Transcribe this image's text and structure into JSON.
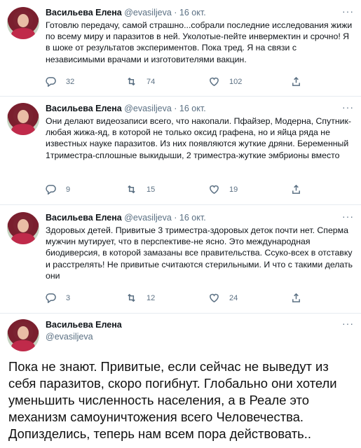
{
  "tweets": [
    {
      "name": "Васильева Елена",
      "handle": "@evasiljeva",
      "dot": "·",
      "date": "16 окт.",
      "text": "Готовлю передачу, самой страшно...собрали последние исследования жижи по всему миру и паразитов в ней. Уколотые-пейте инвермектин и срочно! Я в шоке от результатов экспериментов. Пока тред. Я на связи с независимыми врачами и изготовителями вакцин.",
      "replies": "32",
      "retweets": "74",
      "likes": "102"
    },
    {
      "name": "Васильева Елена",
      "handle": "@evasiljeva",
      "dot": "·",
      "date": "16 окт.",
      "text": "Они делают видеозаписи всего, что накопали. Пфайзер, Модерна, Спутник-любая жижа-яд, в которой не только оксид графена, но и яйца ряда не известных науке паразитов. Из них появляются жуткие дряни. Беременный 1триместра-сплошные выкидыши, 2 триместра-жуткие эмбрионы вместо",
      "replies": "9",
      "retweets": "15",
      "likes": "19"
    },
    {
      "name": "Васильева Елена",
      "handle": "@evasiljeva",
      "dot": "·",
      "date": "16 окт.",
      "text": "Здоровых детей. Привитые 3 триместра-здоровых деток почти нет. Сперма мужчин мутирует, что в перспективе-не ясно. Это международная биодиверсия, в которой замазаны все правительства. Ссуко-всех в отставку и расстрелять! Не привитые считаются стерильными. И что с такими делать они",
      "replies": "3",
      "retweets": "12",
      "likes": "24"
    }
  ],
  "last_tweet": {
    "name": "Васильева Елена",
    "handle": "@evasiljeva",
    "text": "Пока не знают. Привитые, если сейчас не выведут из себя паразитов, скоро погибнут. Глобально они хотели уменьшить численность населения, а в Реале это механизм самоуничтожения всего Человечества. Допизделись, теперь нам всем пора действовать.."
  },
  "more_label": "···"
}
